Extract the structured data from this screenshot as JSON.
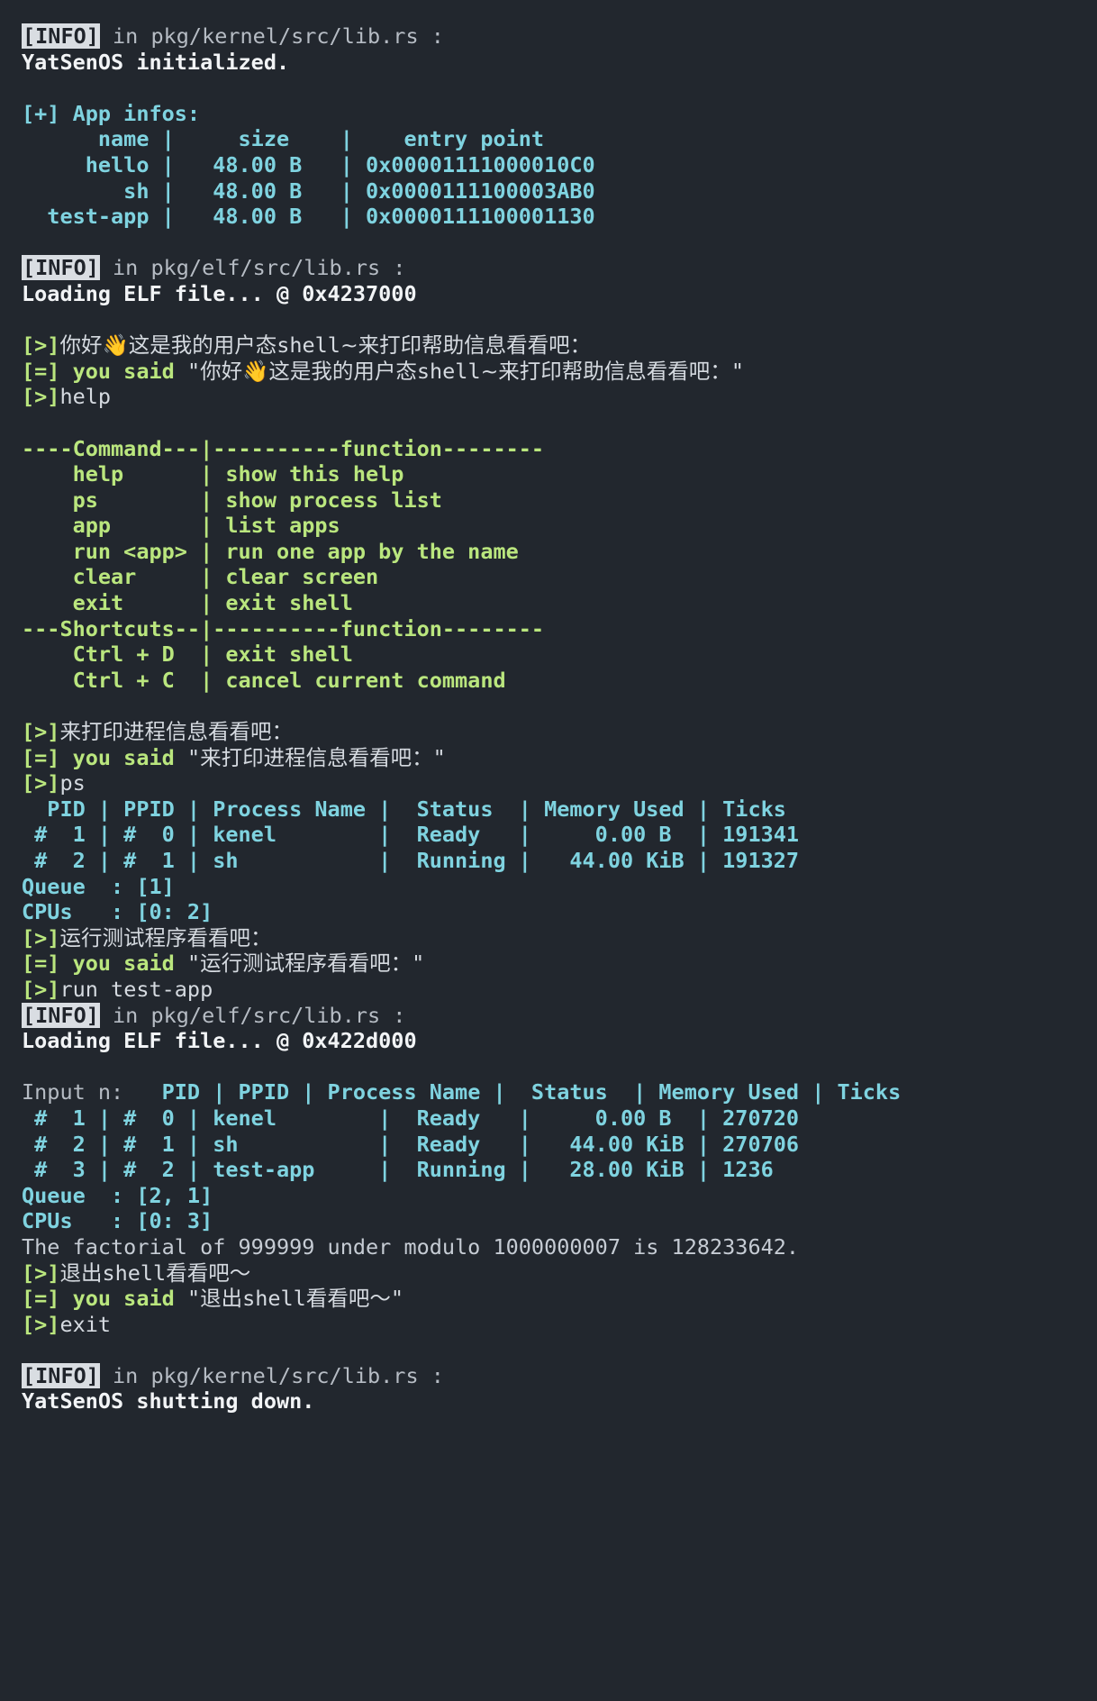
{
  "terminal": {
    "background": "#22272e",
    "colors": {
      "info_badge_bg": "#d9dde2",
      "info_badge_fg": "#20242b",
      "grey": "#b6bcc4",
      "white": "#f2f4f6",
      "cyan": "#7fd3e0",
      "green": "#bae67e",
      "cjk": "#d5dae0"
    },
    "lines": [
      {
        "id": "l1",
        "kind": "info",
        "badge": "[INFO]",
        "text": " in pkg/kernel/src/lib.rs :"
      },
      {
        "id": "l2",
        "kind": "white",
        "text": "YatSenOS initialized."
      },
      {
        "id": "l3",
        "kind": "blank",
        "text": ""
      },
      {
        "id": "l4",
        "kind": "cyan",
        "text": "[+] App infos:"
      },
      {
        "id": "l5",
        "kind": "cyan",
        "text": "      name |     size    |    entry point"
      },
      {
        "id": "l6",
        "kind": "cyan",
        "text": "     hello |   48.00 B   | 0x00001111000010C0"
      },
      {
        "id": "l7",
        "kind": "cyan",
        "text": "        sh |   48.00 B   | 0x0000111100003AB0"
      },
      {
        "id": "l8",
        "kind": "cyan",
        "text": "  test-app |   48.00 B   | 0x0000111100001130"
      },
      {
        "id": "l9",
        "kind": "blank",
        "text": ""
      },
      {
        "id": "l10",
        "kind": "info",
        "badge": "[INFO]",
        "text": " in pkg/elf/src/lib.rs :"
      },
      {
        "id": "l11",
        "kind": "white",
        "text": "Loading ELF file... @ 0x4237000"
      },
      {
        "id": "l12",
        "kind": "blank",
        "text": ""
      },
      {
        "id": "l13",
        "kind": "prompt",
        "prefix": "[>]",
        "text": "你好👋这是我的用户态shell~来打印帮助信息看看吧："
      },
      {
        "id": "l14",
        "kind": "said",
        "prefix": "[=] you said ",
        "text": "\"你好👋这是我的用户态shell~来打印帮助信息看看吧：\""
      },
      {
        "id": "l15",
        "kind": "prompt",
        "prefix": "[>]",
        "text": "help"
      },
      {
        "id": "l16",
        "kind": "blank",
        "text": ""
      },
      {
        "id": "l17",
        "kind": "green",
        "text": "----Command---|----------function--------"
      },
      {
        "id": "l18",
        "kind": "green",
        "text": "    help      | show this help"
      },
      {
        "id": "l19",
        "kind": "green",
        "text": "    ps        | show process list"
      },
      {
        "id": "l20",
        "kind": "green",
        "text": "    app       | list apps"
      },
      {
        "id": "l21",
        "kind": "green",
        "text": "    run <app> | run one app by the name"
      },
      {
        "id": "l22",
        "kind": "green",
        "text": "    clear     | clear screen"
      },
      {
        "id": "l23",
        "kind": "green",
        "text": "    exit      | exit shell"
      },
      {
        "id": "l24",
        "kind": "green",
        "text": "---Shortcuts--|----------function--------"
      },
      {
        "id": "l25",
        "kind": "green",
        "text": "    Ctrl + D  | exit shell"
      },
      {
        "id": "l26",
        "kind": "green",
        "text": "    Ctrl + C  | cancel current command"
      },
      {
        "id": "l27",
        "kind": "blank",
        "text": ""
      },
      {
        "id": "l28",
        "kind": "prompt",
        "prefix": "[>]",
        "text": "来打印进程信息看看吧："
      },
      {
        "id": "l29",
        "kind": "said",
        "prefix": "[=] you said ",
        "text": "\"来打印进程信息看看吧：\""
      },
      {
        "id": "l30",
        "kind": "prompt",
        "prefix": "[>]",
        "text": "ps"
      },
      {
        "id": "l31",
        "kind": "cyan",
        "text": "  PID | PPID | Process Name |  Status  | Memory Used | Ticks"
      },
      {
        "id": "l32",
        "kind": "cyan",
        "text": " #  1 | #  0 | kenel        |  Ready   |     0.00 B  | 191341"
      },
      {
        "id": "l33",
        "kind": "cyan",
        "text": " #  2 | #  1 | sh           |  Running |   44.00 KiB | 191327"
      },
      {
        "id": "l34",
        "kind": "cyan",
        "text": "Queue  : [1]"
      },
      {
        "id": "l35",
        "kind": "cyan",
        "text": "CPUs   : [0: 2]"
      },
      {
        "id": "l36",
        "kind": "prompt",
        "prefix": "[>]",
        "text": "运行测试程序看看吧："
      },
      {
        "id": "l37",
        "kind": "said",
        "prefix": "[=] you said ",
        "text": "\"运行测试程序看看吧：\""
      },
      {
        "id": "l38",
        "kind": "prompt",
        "prefix": "[>]",
        "text": "run test-app"
      },
      {
        "id": "l39",
        "kind": "info",
        "badge": "[INFO]",
        "text": " in pkg/elf/src/lib.rs :"
      },
      {
        "id": "l40",
        "kind": "white",
        "text": "Loading ELF file... @ 0x422d000"
      },
      {
        "id": "l41",
        "kind": "blank",
        "text": ""
      },
      {
        "id": "l42",
        "kind": "inputn",
        "prefix": "Input n:  ",
        "text": " PID | PPID | Process Name |  Status  | Memory Used | Ticks"
      },
      {
        "id": "l43",
        "kind": "cyan",
        "text": " #  1 | #  0 | kenel        |  Ready   |     0.00 B  | 270720"
      },
      {
        "id": "l44",
        "kind": "cyan",
        "text": " #  2 | #  1 | sh           |  Ready   |   44.00 KiB | 270706"
      },
      {
        "id": "l45",
        "kind": "cyan",
        "text": " #  3 | #  2 | test-app     |  Running |   28.00 KiB | 1236"
      },
      {
        "id": "l46",
        "kind": "cyan",
        "text": "Queue  : [2, 1]"
      },
      {
        "id": "l47",
        "kind": "cyan",
        "text": "CPUs   : [0: 3]"
      },
      {
        "id": "l48",
        "kind": "plain",
        "text": "The factorial of 999999 under modulo 1000000007 is 128233642."
      },
      {
        "id": "l49",
        "kind": "prompt",
        "prefix": "[>]",
        "text": "退出shell看看吧～"
      },
      {
        "id": "l50",
        "kind": "said",
        "prefix": "[=] you said ",
        "text": "\"退出shell看看吧～\""
      },
      {
        "id": "l51",
        "kind": "prompt",
        "prefix": "[>]",
        "text": "exit"
      },
      {
        "id": "l52",
        "kind": "blank",
        "text": ""
      },
      {
        "id": "l53",
        "kind": "info",
        "badge": "[INFO]",
        "text": " in pkg/kernel/src/lib.rs :"
      },
      {
        "id": "l54",
        "kind": "white",
        "text": "YatSenOS shutting down."
      }
    ]
  }
}
